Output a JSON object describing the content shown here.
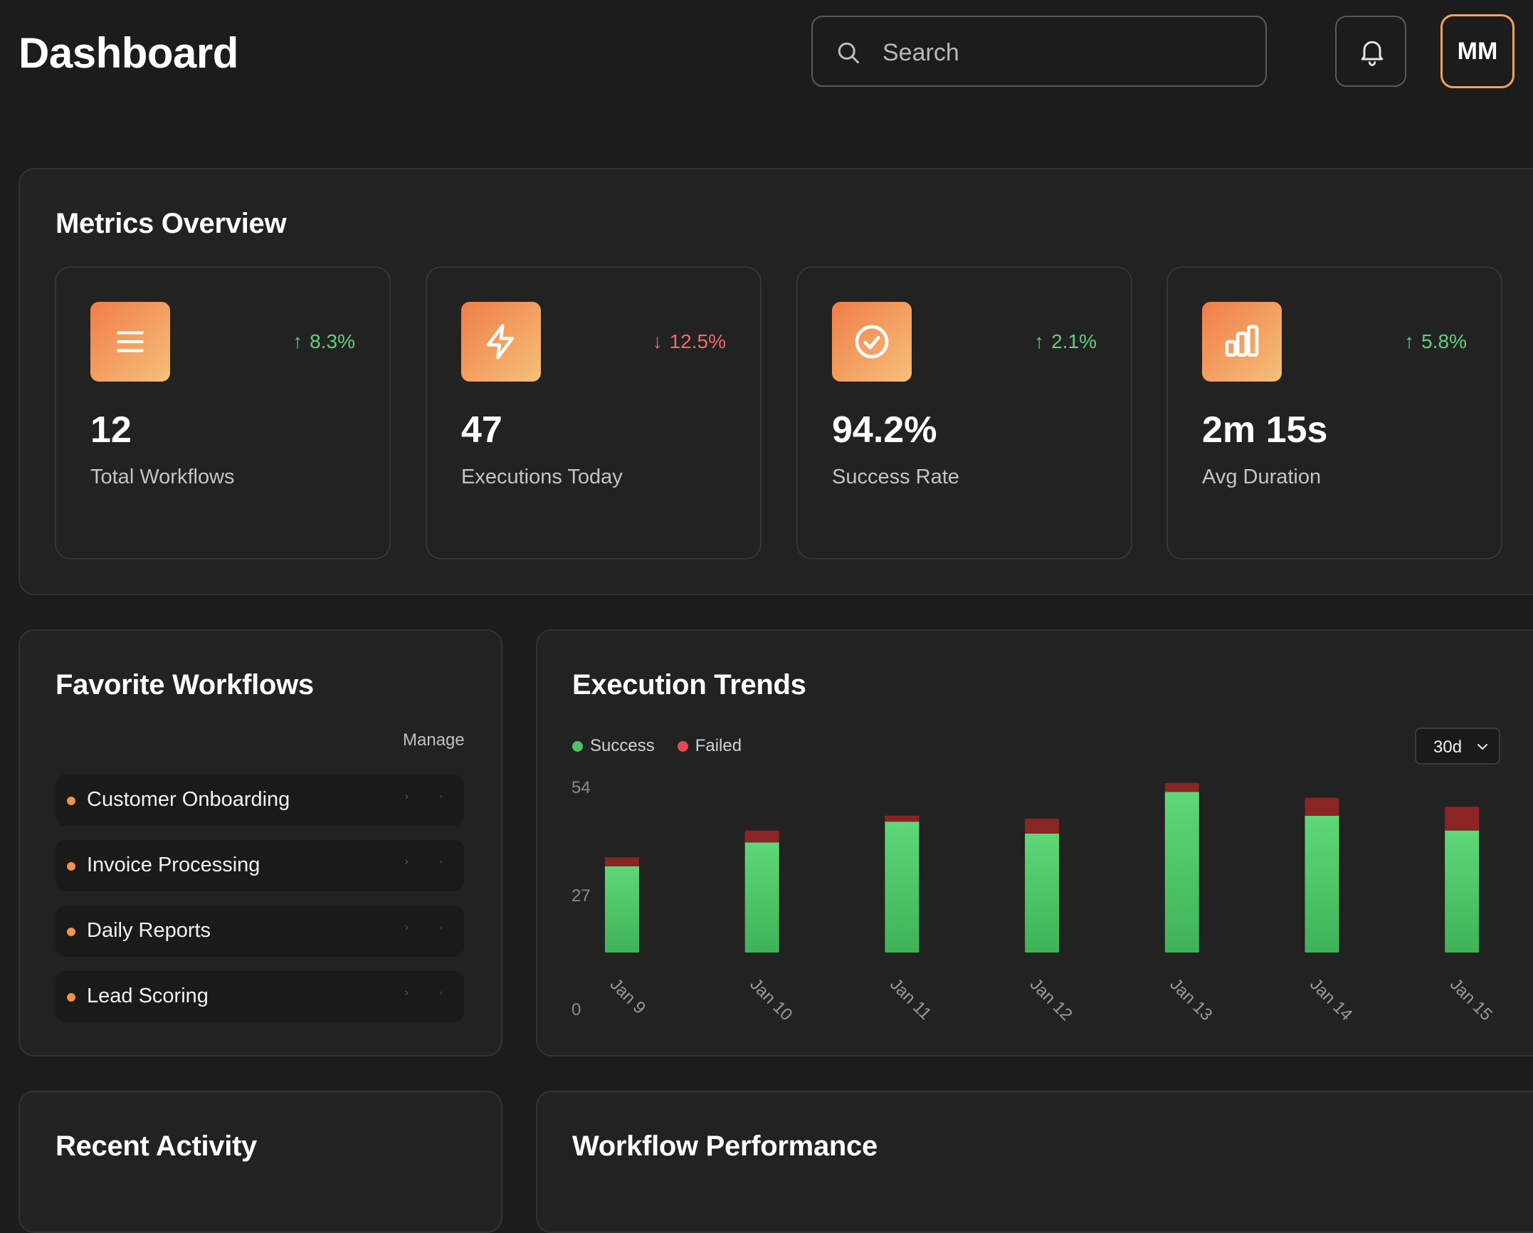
{
  "header": {
    "title": "Dashboard",
    "search_placeholder": "Search",
    "avatar_initials": "MM"
  },
  "metrics": {
    "title": "Metrics Overview",
    "cards": [
      {
        "icon": "list-icon",
        "trend_dir": "up",
        "trend": "8.3%",
        "value": "12",
        "label": "Total Workflows"
      },
      {
        "icon": "lightning-icon",
        "trend_dir": "down",
        "trend": "12.5%",
        "value": "47",
        "label": "Executions Today"
      },
      {
        "icon": "check-circle-icon",
        "trend_dir": "up",
        "trend": "2.1%",
        "value": "94.2%",
        "label": "Success Rate"
      },
      {
        "icon": "bar-chart-icon",
        "trend_dir": "up",
        "trend": "5.8%",
        "value": "2m 15s",
        "label": "Avg Duration"
      }
    ]
  },
  "favorites": {
    "title": "Favorite Workflows",
    "manage_label": "Manage",
    "items": [
      {
        "label": "Customer Onboarding"
      },
      {
        "label": "Invoice Processing"
      },
      {
        "label": "Daily Reports"
      },
      {
        "label": "Lead Scoring"
      }
    ]
  },
  "trends": {
    "title": "Execution Trends",
    "range_label": "30d"
  },
  "chart_data": {
    "type": "bar",
    "stacked": true,
    "categories": [
      "Jan 9",
      "Jan 10",
      "Jan 11",
      "Jan 12",
      "Jan 13",
      "Jan 14",
      "Jan 15"
    ],
    "series": [
      {
        "name": "Success",
        "values": [
          29,
          37,
          44,
          40,
          54,
          46,
          41
        ],
        "color": "#4cc463"
      },
      {
        "name": "Failed",
        "values": [
          3,
          4,
          2,
          5,
          3,
          6,
          8
        ],
        "color": "#8b2424"
      }
    ],
    "yticks": [
      "54",
      "27",
      "0"
    ],
    "ylim": [
      0,
      54
    ],
    "legend": "top-left",
    "grid": false
  },
  "recent_activity": {
    "title": "Recent Activity"
  },
  "performance": {
    "title": "Workflow Performance"
  }
}
